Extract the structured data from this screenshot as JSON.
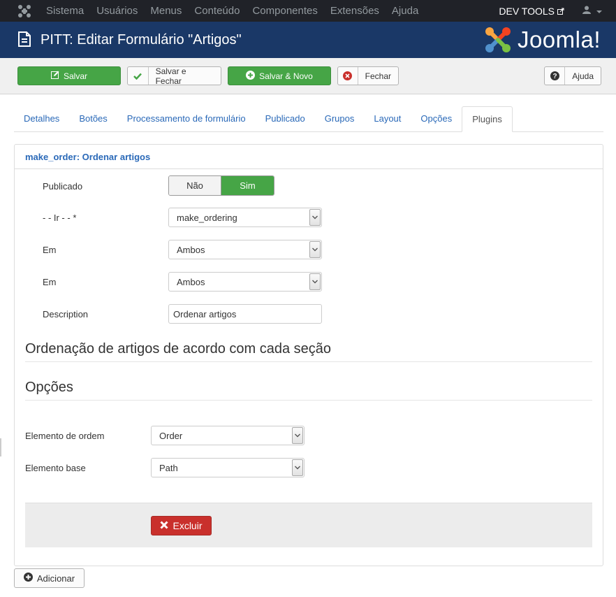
{
  "topbar": {
    "menu": [
      "Sistema",
      "Usuários",
      "Menus",
      "Conteúdo",
      "Componentes",
      "Extensões",
      "Ajuda"
    ],
    "devtools": "DEV TOOLS"
  },
  "header": {
    "title": "PITT: Editar Formulário \"Artigos\"",
    "brand": "Joomla!"
  },
  "toolbar": {
    "save": "Salvar",
    "save_close": "Salvar e Fechar",
    "save_new": "Salvar & Novo",
    "close": "Fechar",
    "help": "Ajuda"
  },
  "tabs": [
    "Detalhes",
    "Botões",
    "Processamento de formulário",
    "Publicado",
    "Grupos",
    "Layout",
    "Opções",
    "Plugins"
  ],
  "active_tab": "Plugins",
  "plugin": {
    "heading": "make_order: Ordenar artigos",
    "published_label": "Publicado",
    "published_no": "Não",
    "published_yes": "Sim",
    "published_value": "Sim",
    "go_label": "- - Ir - - *",
    "go_value": "make_ordering",
    "em1_label": "Em",
    "em1_value": "Ambos",
    "em2_label": "Em",
    "em2_value": "Ambos",
    "description_label": "Description",
    "description_value": "Ordenar artigos",
    "section_heading": "Ordenação de artigos de acordo com cada seção",
    "options_heading": "Opções",
    "order_element_label": "Elemento de ordem",
    "order_element_value": "Order",
    "base_element_label": "Elemento base",
    "base_element_value": "Path",
    "delete_label": "Excluir"
  },
  "add_label": "Adicionar",
  "colors": {
    "navbar": "#202228",
    "header": "#1a3867",
    "green": "#46a546",
    "red": "#c9302c",
    "link": "#2a69b8"
  }
}
